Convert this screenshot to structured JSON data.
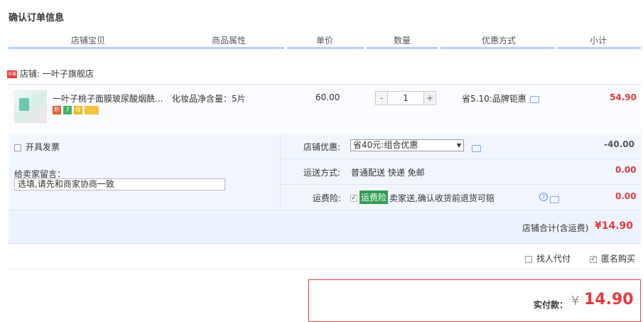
{
  "title": "确认订单信息",
  "columns": [
    "店铺宝贝",
    "商品属性",
    "单价",
    "数量",
    "优惠方式",
    "小计"
  ],
  "shop": {
    "badge": "天猫",
    "label": "店铺: 一叶子旗舰店"
  },
  "item": {
    "title": "一叶子桃子面膜玻尿酸烟酰...",
    "attribute": "化妆品净含量：5片",
    "price": "60.00",
    "quantity": "1",
    "minus": "-",
    "plus": "+",
    "promotion": "省5.10:品牌钜惠",
    "subtotal": "54.90",
    "badges": [
      "积",
      "7",
      "保",
      ""
    ]
  },
  "options": {
    "invoice_label": "开具发票",
    "message_label": "给卖家留言：",
    "message_placeholder": "选填,请先和商家协商一致",
    "shop_discount_label": "店铺优惠:",
    "shop_discount_value": "省40元:组合优惠",
    "shop_discount_amount": "-40.00",
    "shipping_label": "运送方式:",
    "shipping_value": "普通配送 快递 免邮",
    "shipping_fee": "0.00",
    "insurance_label": "运费险:",
    "insurance_name": "运费险",
    "insurance_desc": "卖家送,确认收货前退货可赔",
    "insurance_fee": "0.00",
    "help_glyph": "?"
  },
  "shop_total": {
    "label": "店铺合计(含运费)",
    "value": "¥14.90"
  },
  "extras": {
    "others_pay": "找人代付",
    "anonymous": "匿名购买"
  },
  "payment": {
    "label": "实付款：",
    "currency": "¥",
    "value": "14.90"
  },
  "colors": {
    "accent": "#e4393c",
    "header_line": "#b2d1ff",
    "panel": "#f2f6ff"
  }
}
